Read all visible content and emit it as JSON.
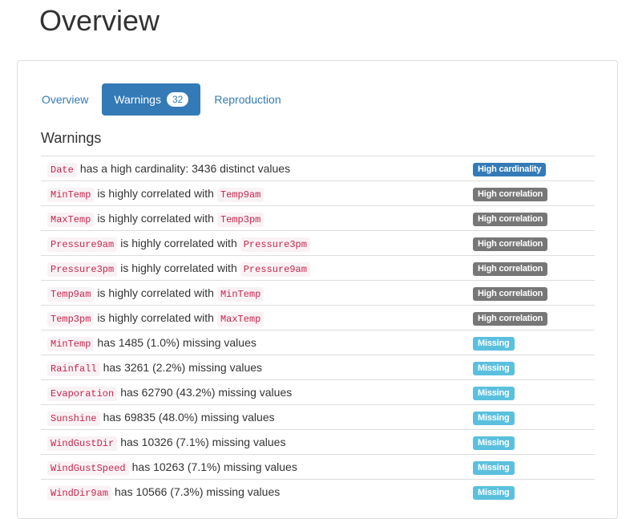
{
  "page": {
    "title": "Overview"
  },
  "tabs": [
    {
      "label": "Overview"
    },
    {
      "label": "Warnings",
      "count": "32"
    },
    {
      "label": "Reproduction"
    }
  ],
  "section": {
    "title": "Warnings"
  },
  "connectors": {
    "high_cardinality": "has a high cardinality: 3436 distinct values",
    "correlated": "is highly correlated with",
    "has": "has",
    "missing_suffix": "missing values"
  },
  "warnings": [
    {
      "col": "Date",
      "text": "has a high cardinality: 3436 distinct values",
      "label": "High cardinality",
      "type": "primary"
    },
    {
      "col": "MinTemp",
      "text": "is highly correlated with",
      "other": "Temp9am",
      "label": "High correlation",
      "type": "default"
    },
    {
      "col": "MaxTemp",
      "text": "is highly correlated with",
      "other": "Temp3pm",
      "label": "High correlation",
      "type": "default"
    },
    {
      "col": "Pressure9am",
      "text": "is highly correlated with",
      "other": "Pressure3pm",
      "label": "High correlation",
      "type": "default"
    },
    {
      "col": "Pressure3pm",
      "text": "is highly correlated with",
      "other": "Pressure9am",
      "label": "High correlation",
      "type": "default"
    },
    {
      "col": "Temp9am",
      "text": "is highly correlated with",
      "other": "MinTemp",
      "label": "High correlation",
      "type": "default"
    },
    {
      "col": "Temp3pm",
      "text": "is highly correlated with",
      "other": "MaxTemp",
      "label": "High correlation",
      "type": "default"
    },
    {
      "col": "MinTemp",
      "text": "has 1485 (1.0%) missing values",
      "label": "Missing",
      "type": "info"
    },
    {
      "col": "Rainfall",
      "text": "has 3261 (2.2%) missing values",
      "label": "Missing",
      "type": "info"
    },
    {
      "col": "Evaporation",
      "text": "has 62790 (43.2%) missing values",
      "label": "Missing",
      "type": "info"
    },
    {
      "col": "Sunshine",
      "text": "has 69835 (48.0%) missing values",
      "label": "Missing",
      "type": "info"
    },
    {
      "col": "WindGustDir",
      "text": "has 10326 (7.1%) missing values",
      "label": "Missing",
      "type": "info"
    },
    {
      "col": "WindGustSpeed",
      "text": "has 10263 (7.1%) missing values",
      "label": "Missing",
      "type": "info"
    },
    {
      "col": "WindDir9am",
      "text": "has 10566 (7.3%) missing values",
      "label": "Missing",
      "type": "info"
    }
  ],
  "colors": {
    "primary": "#337ab7",
    "default": "#777777",
    "info": "#5bc0de",
    "code": "#c7254e"
  }
}
